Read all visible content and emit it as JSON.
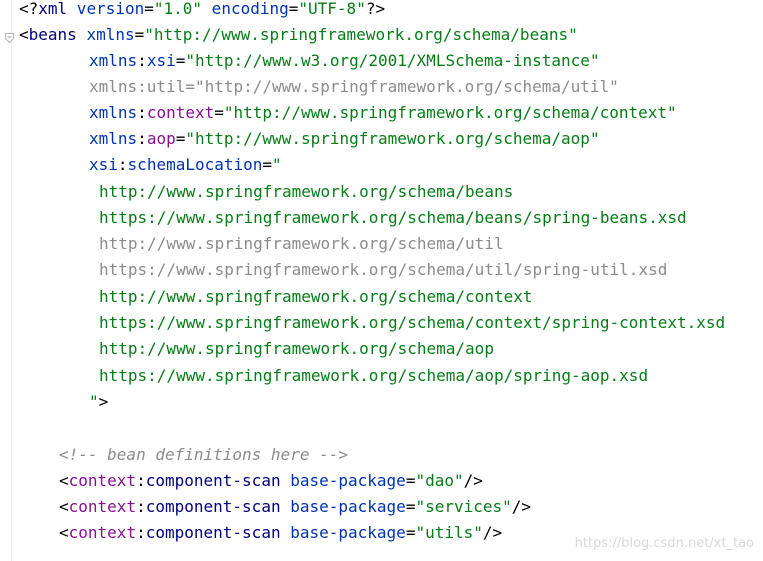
{
  "watermark": "https://blog.csdn.net/xt_tao",
  "syntax_colors": {
    "tag": "#000080",
    "namespace_prefix": "#871094",
    "attribute": "#0033b3",
    "attribute_value": "#067d17",
    "unused": "#8c8c8c",
    "comment": "#8c8c8c"
  },
  "code": {
    "l1": {
      "a": "<?",
      "b": "xml",
      "c": " version",
      "d": "=",
      "e": "\"1.0\"",
      "f": " encoding",
      "g": "=",
      "h": "\"UTF-8\"",
      "i": "?>"
    },
    "l2": {
      "a": "<",
      "b": "beans",
      "c": " xmlns",
      "d": "=",
      "e": "\"http://www.springframework.org/schema/beans\""
    },
    "l3": {
      "a": "xmlns",
      "b": ":",
      "c": "xsi",
      "d": "=",
      "e": "\"http://www.w3.org/2001/XMLSchema-instance\""
    },
    "l4": {
      "a": "xmlns:util=\"http://www.springframework.org/schema/util\""
    },
    "l5": {
      "a": "xmlns",
      "b": ":",
      "c": "context",
      "d": "=",
      "e": "\"http://www.springframework.org/schema/context\""
    },
    "l6": {
      "a": "xmlns",
      "b": ":",
      "c": "aop",
      "d": "=",
      "e": "\"http://www.springframework.org/schema/aop\""
    },
    "l7": {
      "a": "xsi",
      "b": ":",
      "c": "schemaLocation",
      "d": "=",
      "e": "\""
    },
    "l8": "http://www.springframework.org/schema/beans",
    "l9": "https://www.springframework.org/schema/beans/spring-beans.xsd",
    "l10": "http://www.springframework.org/schema/util",
    "l11": "https://www.springframework.org/schema/util/spring-util.xsd",
    "l12": "http://www.springframework.org/schema/context",
    "l13": "https://www.springframework.org/schema/context/spring-context.xsd",
    "l14": "http://www.springframework.org/schema/aop",
    "l15": "https://www.springframework.org/schema/aop/spring-aop.xsd",
    "l16": {
      "a": "\"",
      "b": ">"
    },
    "l18": "<!-- bean definitions here -->",
    "l19": {
      "a": "<",
      "b": "context",
      "c": ":",
      "d": "component-scan",
      "e": " base-package",
      "f": "=",
      "g": "\"dao\"",
      "h": "/>"
    },
    "l20": {
      "a": "<",
      "b": "context",
      "c": ":",
      "d": "component-scan",
      "e": " base-package",
      "f": "=",
      "g": "\"services\"",
      "h": "/>"
    },
    "l21": {
      "a": "<",
      "b": "context",
      "c": ":",
      "d": "component-scan",
      "e": " base-package",
      "f": "=",
      "g": "\"utils\"",
      "h": "/>"
    }
  }
}
